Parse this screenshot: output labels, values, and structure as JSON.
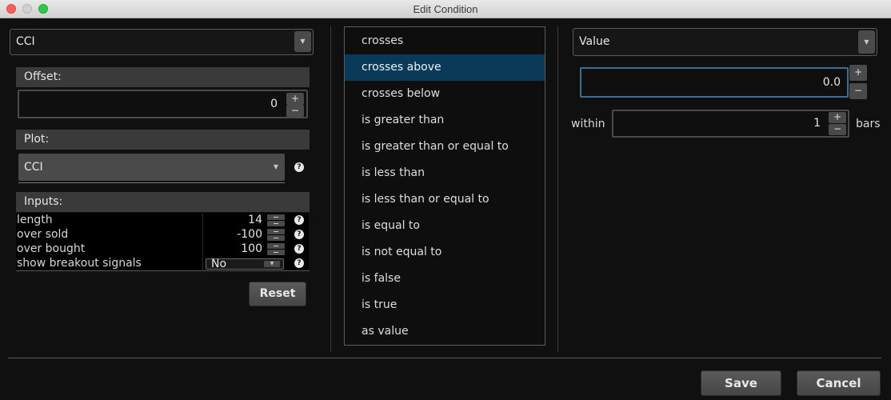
{
  "window": {
    "title": "Edit Condition"
  },
  "left": {
    "study_dropdown": {
      "value": "CCI"
    },
    "offset": {
      "header": "Offset:",
      "value": "0"
    },
    "plot": {
      "header": "Plot:",
      "value": "CCI"
    },
    "inputs": {
      "header": "Inputs:",
      "rows": [
        {
          "label": "length",
          "value": "14"
        },
        {
          "label": "over sold",
          "value": "-100"
        },
        {
          "label": "over bought",
          "value": "100"
        },
        {
          "label": "show breakout signals",
          "value": "No"
        }
      ]
    },
    "reset_label": "Reset"
  },
  "middle": {
    "conditions": [
      "crosses",
      "crosses above",
      "crosses below",
      "is greater than",
      "is greater than or equal to",
      "is less than",
      "is less than or equal to",
      "is equal to",
      "is not equal to",
      "is false",
      "is true",
      "as value"
    ],
    "selected_index": 1
  },
  "right": {
    "target_dropdown": {
      "value": "Value"
    },
    "value_field": {
      "value": "0.0"
    },
    "within": {
      "label": "within",
      "value": "1",
      "unit": "bars"
    }
  },
  "footer": {
    "save_label": "Save",
    "cancel_label": "Cancel"
  },
  "colors": {
    "selection": "#0b3a58",
    "background": "#101010",
    "header": "#3a3a3a"
  },
  "icons": {
    "close": "close-icon",
    "minimize": "minimize-icon",
    "maximize": "maximize-icon",
    "dropdown": "chevron-down-icon",
    "help": "question-icon"
  }
}
